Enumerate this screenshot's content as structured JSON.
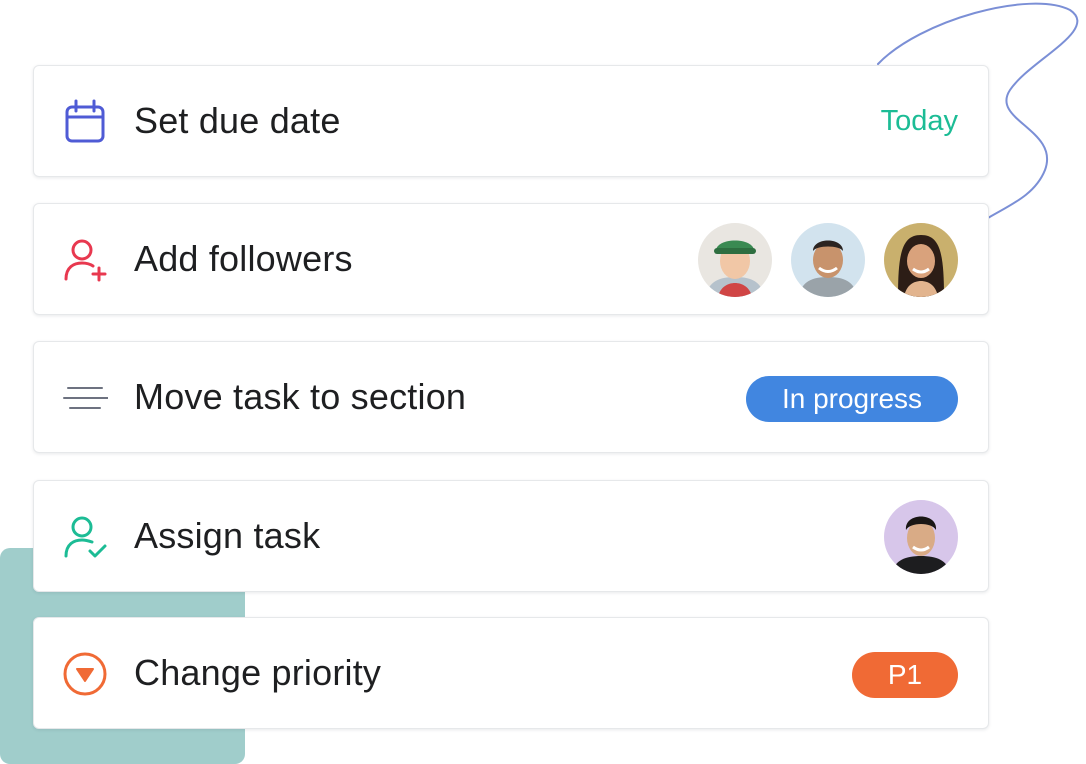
{
  "cards": {
    "due_date": {
      "icon": "calendar-icon",
      "label": "Set due date",
      "value": "Today"
    },
    "followers": {
      "icon": "add-user-icon",
      "label": "Add followers",
      "avatars": [
        "follower-avatar-1",
        "follower-avatar-2",
        "follower-avatar-3"
      ]
    },
    "section": {
      "icon": "lines-icon",
      "label": "Move task to section",
      "value": "In progress"
    },
    "assign": {
      "icon": "assign-user-icon",
      "label": "Assign task",
      "avatars": [
        "assignee-avatar"
      ]
    },
    "priority": {
      "icon": "priority-down-icon",
      "label": "Change priority",
      "value": "P1"
    }
  },
  "colors": {
    "calendar_icon": "#4f5bd5",
    "add_user_icon": "#e8384f",
    "lines_icon": "#6d7280",
    "assign_icon": "#1cbc95",
    "priority_icon": "#f06a35",
    "today_text": "#1cbc95",
    "section_pill": "#4186e0",
    "priority_pill": "#f06a35",
    "teal_block": "#a0cdcb",
    "squiggle": "#7b8fd6"
  }
}
